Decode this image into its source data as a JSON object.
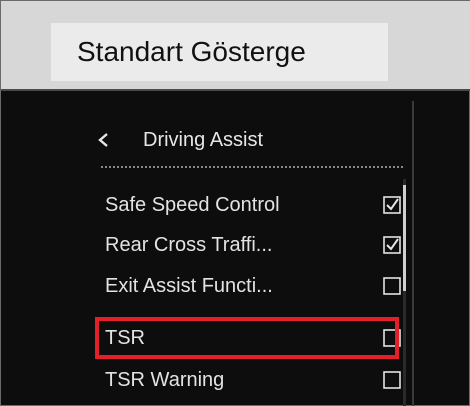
{
  "header": {
    "title": "Standart Gösterge"
  },
  "menu": {
    "back_icon": "chevron-left-icon",
    "title": "Driving Assist"
  },
  "items": [
    {
      "label": "Safe Speed Control",
      "checked": true
    },
    {
      "label": "Rear Cross Traffi...",
      "checked": true
    },
    {
      "label": "Exit Assist Functi...",
      "checked": false
    },
    {
      "label": "TSR",
      "checked": false,
      "highlighted": true
    },
    {
      "label": "TSR Warning",
      "checked": false
    }
  ],
  "scrollbar": {
    "position": "top"
  },
  "colors": {
    "screen_bg": "#0d0d0d",
    "text": "#e3e3e3",
    "highlight": "#e3202a",
    "header_bg": "#d7d7d7"
  }
}
